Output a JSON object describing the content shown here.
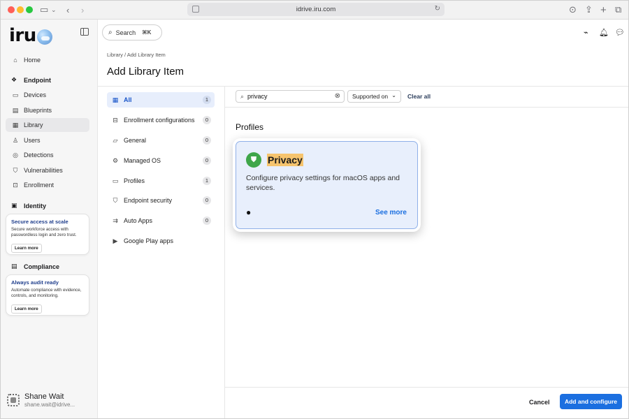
{
  "browser": {
    "url": "idrive.iru.com"
  },
  "brand": {
    "logo_text": "iru"
  },
  "sidebar": {
    "items": [
      {
        "label": "Home",
        "icon": "home-icon"
      },
      {
        "label": "Endpoint",
        "icon": "endpoint-icon"
      },
      {
        "label": "Devices",
        "icon": "devices-icon"
      },
      {
        "label": "Blueprints",
        "icon": "blueprints-icon"
      },
      {
        "label": "Library",
        "icon": "library-icon"
      },
      {
        "label": "Users",
        "icon": "users-icon"
      },
      {
        "label": "Detections",
        "icon": "detections-icon"
      },
      {
        "label": "Vulnerabilities",
        "icon": "vulnerabilities-icon"
      },
      {
        "label": "Enrollment",
        "icon": "enrollment-icon"
      },
      {
        "label": "Identity",
        "icon": "identity-icon"
      },
      {
        "label": "Compliance",
        "icon": "compliance-icon"
      }
    ],
    "active": "Library",
    "promos": [
      {
        "title": "Secure access at scale",
        "desc": "Secure workforce access with passwordless login and zero trust.",
        "button": "Learn more"
      },
      {
        "title": "Always audit ready",
        "desc": "Automate compliance with evidence, controls, and monitoring.",
        "button": "Learn more"
      }
    ],
    "user": {
      "name": "Shane Wait",
      "email": "shane.wait@idrive..."
    }
  },
  "topbar": {
    "search_label": "Search",
    "search_shortcut": "⌘K"
  },
  "breadcrumb": "Library / Add Library Item",
  "page_title": "Add Library Item",
  "categories": [
    {
      "label": "All",
      "count": "1"
    },
    {
      "label": "Enrollment configurations",
      "count": "0"
    },
    {
      "label": "General",
      "count": "0"
    },
    {
      "label": "Managed OS",
      "count": "0"
    },
    {
      "label": "Profiles",
      "count": "1"
    },
    {
      "label": "Endpoint security",
      "count": "0"
    },
    {
      "label": "Auto Apps",
      "count": "0"
    },
    {
      "label": "Google Play apps",
      "count": ""
    }
  ],
  "filters": {
    "search_value": "privacy",
    "supported_label": "Supported on",
    "clear_all": "Clear all"
  },
  "section": {
    "title": "Profiles"
  },
  "card": {
    "title": "Privacy",
    "description": "Configure privacy settings for macOS apps and services.",
    "see_more": "See more",
    "platform_icon": "apple-icon"
  },
  "footer": {
    "cancel": "Cancel",
    "primary": "Add and configure"
  },
  "colors": {
    "accent": "#1b6fe0",
    "highlight": "#f6c46e",
    "card_bg": "#e8effc",
    "shield": "#3fa64a"
  }
}
